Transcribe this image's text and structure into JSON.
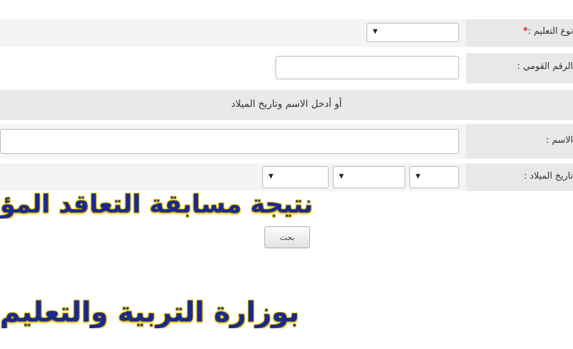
{
  "form": {
    "education_type": {
      "label": "نوع التعليم :",
      "required_mark": "*",
      "value": ""
    },
    "national_id": {
      "label": "الرقم القومي :",
      "value": ""
    },
    "or_section": {
      "text": "أو أدخل الاسم وتاريخ الميلاد"
    },
    "name": {
      "label": "الاسم :",
      "value": ""
    },
    "birth_date": {
      "label": "تاريخ الميلاد :",
      "day": "",
      "month": "",
      "year": ""
    },
    "search_button": {
      "label": "بحث"
    }
  },
  "overlay": {
    "headline_1": "نتيجة مسابقة التعاقد المؤ",
    "headline_2": "بوزارة التربية والتعليم"
  },
  "icons": {
    "dropdown": "▼"
  },
  "colors": {
    "headline": "#1b2a8a",
    "headline_glow": "#d6b600",
    "required": "#d92020"
  }
}
